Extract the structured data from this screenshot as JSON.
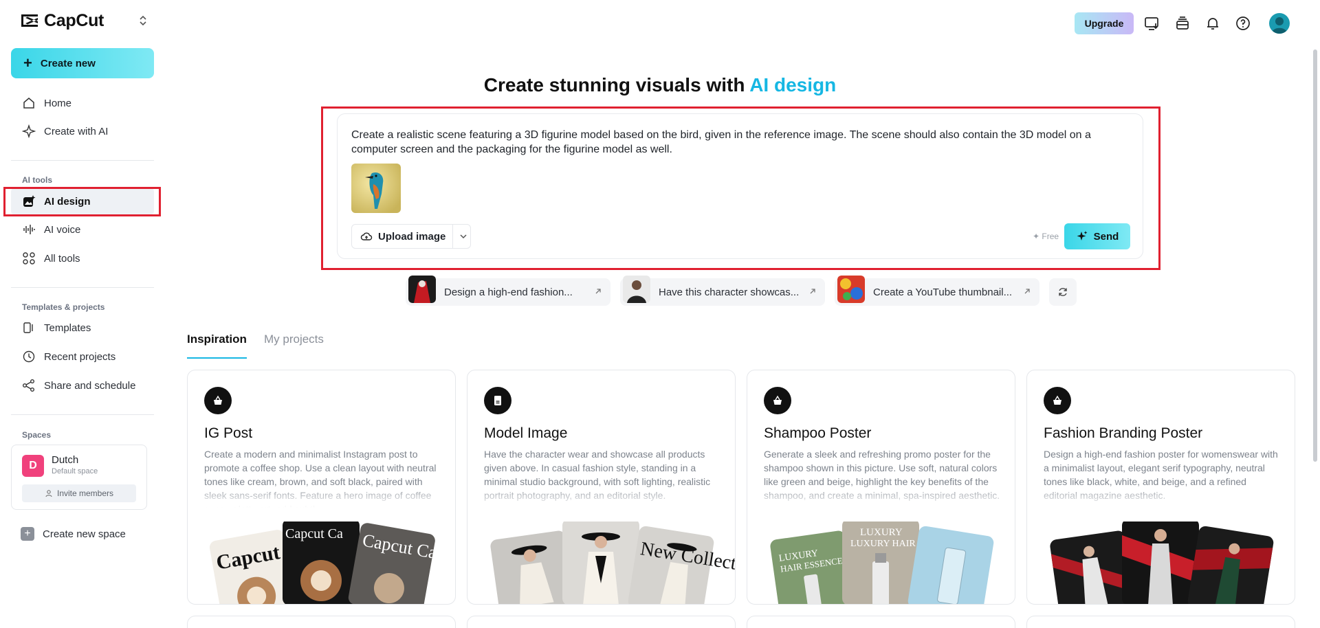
{
  "sidebar": {
    "logo_text": "CapCut",
    "create_new_label": "Create new",
    "nav_main": [
      {
        "label": "Home",
        "icon": "home-icon"
      },
      {
        "label": "Create with AI",
        "icon": "sparkle-icon"
      }
    ],
    "ai_tools_label": "AI tools",
    "ai_tools": [
      {
        "label": "AI design",
        "icon": "ai-design-icon",
        "active": true
      },
      {
        "label": "AI voice",
        "icon": "waveform-icon"
      },
      {
        "label": "All tools",
        "icon": "grid-icon"
      }
    ],
    "templates_label": "Templates & projects",
    "templates": [
      {
        "label": "Templates",
        "icon": "template-icon"
      },
      {
        "label": "Recent projects",
        "icon": "clock-icon"
      },
      {
        "label": "Share and schedule",
        "icon": "share-icon"
      }
    ],
    "spaces_label": "Spaces",
    "space": {
      "initial": "D",
      "name": "Dutch",
      "sub": "Default space",
      "invite_label": "Invite members"
    },
    "create_space_label": "Create new space"
  },
  "header": {
    "upgrade_label": "Upgrade",
    "icons": [
      "monitor-download-icon",
      "stack-icon",
      "bell-icon",
      "help-icon",
      "avatar"
    ]
  },
  "main": {
    "title_prefix": "Create stunning visuals with",
    "title_accent": "AI design",
    "prompt_text": "Create a realistic scene featuring a 3D figurine model based on the bird, given in the reference image. The scene should also contain the 3D model on a computer screen and the packaging for the figurine model as well.",
    "upload_label": "Upload image",
    "free_label": "✦ Free",
    "send_label": "Send",
    "suggestions": [
      {
        "label": "Design a high-end fashion..."
      },
      {
        "label": "Have this character showcas..."
      },
      {
        "label": "Create a YouTube thumbnail..."
      }
    ],
    "tabs": [
      {
        "label": "Inspiration",
        "active": true
      },
      {
        "label": "My projects",
        "active": false
      }
    ],
    "cards": [
      {
        "title": "IG Post",
        "desc": "Create a modern and minimalist Instagram post to promote a coffee shop. Use a clean layout with neutral tones like cream, brown, and soft black, paired with sleek sans-serif fonts. Feature a hero image of coffee cups or latte art, add subtle",
        "art_text": "Capcut Cafe"
      },
      {
        "title": "Model Image",
        "desc": "Have the character wear and showcase all products given above. In casual fashion style, standing in a minimal studio background, with soft lighting, realistic portrait photography, and an editorial style.",
        "art_text": "New Collection"
      },
      {
        "title": "Shampoo Poster",
        "desc": "Generate a sleek and refreshing promo poster for the shampoo shown in this picture. Use soft, natural colors like green and beige, highlight the key benefits of the shampoo, and create a minimal, spa-inspired aesthetic.",
        "art_text": "LUXURY HAIR ESSENCE"
      },
      {
        "title": "Fashion Branding Poster",
        "desc": "Design a high-end fashion poster for womenswear with a minimalist layout, elegant serif typography, neutral tones like black, white, and beige, and a refined editorial magazine aesthetic.",
        "art_text": ""
      }
    ]
  },
  "colors": {
    "accent": "#16b7e3",
    "highlight": "#e02030",
    "brand_gradient_start": "#3ad6e8"
  }
}
